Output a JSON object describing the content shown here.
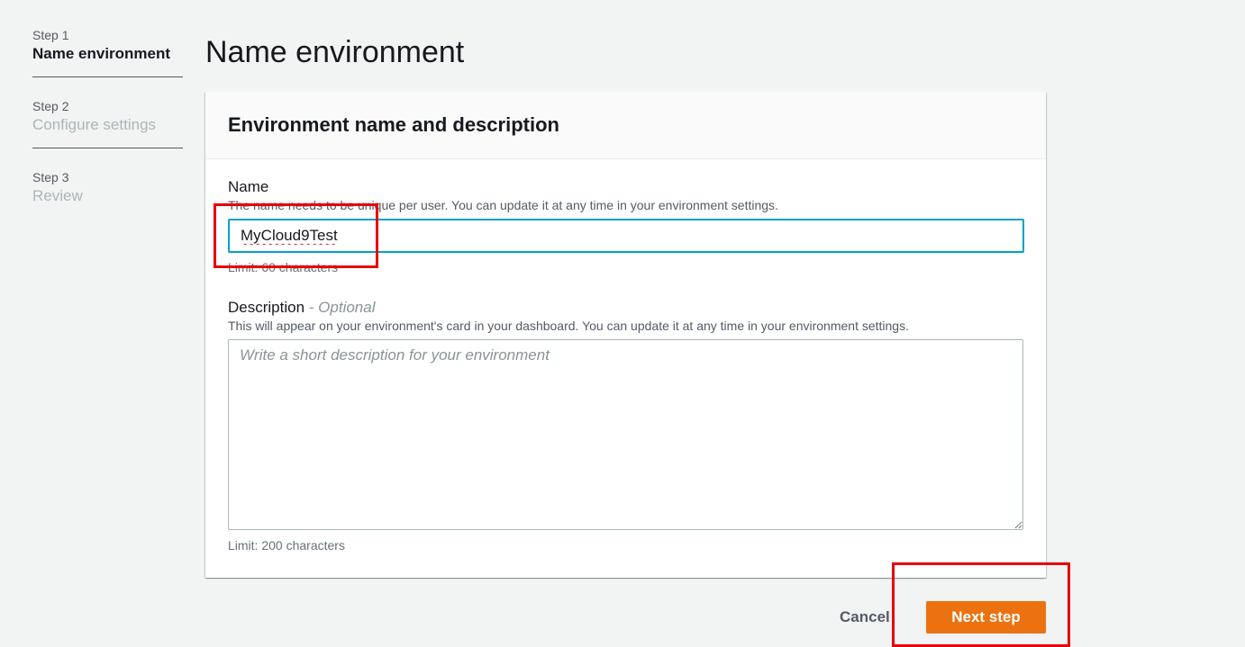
{
  "steps": [
    {
      "number": "Step 1",
      "title": "Name environment",
      "active": true
    },
    {
      "number": "Step 2",
      "title": "Configure settings",
      "active": false
    },
    {
      "number": "Step 3",
      "title": "Review",
      "active": false
    }
  ],
  "page": {
    "title": "Name environment"
  },
  "card": {
    "title": "Environment name and description",
    "name_field": {
      "label": "Name",
      "description": "The name needs to be unique per user. You can update it at any time in your environment settings.",
      "value": "MyCloud9Test",
      "hint": "Limit: 60 characters"
    },
    "description_field": {
      "label": "Description",
      "optional_label": "- Optional",
      "description": "This will appear on your environment's card in your dashboard. You can update it at any time in your environment settings.",
      "value": "",
      "placeholder": "Write a short description for your environment",
      "hint": "Limit: 200 characters"
    }
  },
  "actions": {
    "cancel_label": "Cancel",
    "next_label": "Next step"
  },
  "colors": {
    "primary_button": "#ec7211",
    "focus_border": "#00a1c9",
    "highlight": "#e8000b"
  }
}
